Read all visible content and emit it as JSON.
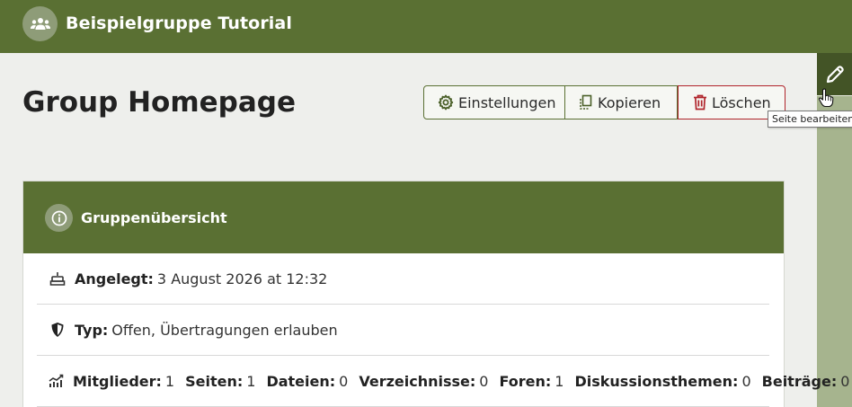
{
  "header": {
    "group_name": "Beispielgruppe Tutorial",
    "group_icon": "group-icon"
  },
  "page": {
    "title": "Group Homepage"
  },
  "actions": {
    "settings_label": "Einstellungen",
    "copy_label": "Kopieren",
    "delete_label": "Löschen"
  },
  "edit": {
    "tooltip": "Seite bearbeiten",
    "icon": "pencil-icon"
  },
  "overview": {
    "title": "Gruppenübersicht",
    "created_label": "Angelegt:",
    "created_value": "3 August 2026 at 12:32",
    "type_label": "Typ:",
    "type_value": "Offen, Übertragungen erlauben",
    "stats": [
      {
        "label": "Mitglieder:",
        "value": "1"
      },
      {
        "label": "Seiten:",
        "value": "1"
      },
      {
        "label": "Dateien:",
        "value": "0"
      },
      {
        "label": "Verzeichnisse:",
        "value": "0"
      },
      {
        "label": "Foren:",
        "value": "1"
      },
      {
        "label": "Diskussionsthemen:",
        "value": "0"
      },
      {
        "label": "Beiträge:",
        "value": "0"
      }
    ]
  },
  "colors": {
    "brand_green": "#5a7033",
    "dark_green": "#435426",
    "danger_red": "#b0242b"
  }
}
